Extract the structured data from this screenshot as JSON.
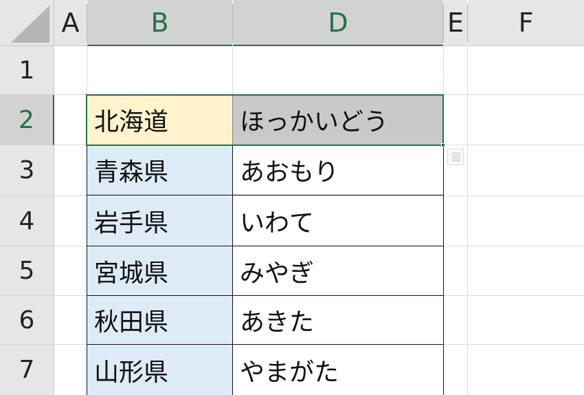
{
  "columns": {
    "a": "A",
    "b": "B",
    "d": "D",
    "e": "E",
    "f": "F"
  },
  "rows": [
    "1",
    "2",
    "3",
    "4",
    "5",
    "6",
    "7"
  ],
  "table": [
    {
      "pref": "北海道",
      "kana": "ほっかいどう"
    },
    {
      "pref": "青森県",
      "kana": "あおもり"
    },
    {
      "pref": "岩手県",
      "kana": "いわて"
    },
    {
      "pref": "宮城県",
      "kana": "みやぎ"
    },
    {
      "pref": "秋田県",
      "kana": "あきた"
    },
    {
      "pref": "山形県",
      "kana": "やまがた"
    }
  ],
  "colors": {
    "selection": "#217346",
    "header_bg": "#e6e6e6",
    "header_selected_bg": "#d2d2d2",
    "col_b_fill": "#ddebf7",
    "b2_fill": "#fff2cc",
    "d2_fill": "#c9c9c9"
  },
  "icons": {
    "quick_analysis": "quick-analysis-icon"
  }
}
